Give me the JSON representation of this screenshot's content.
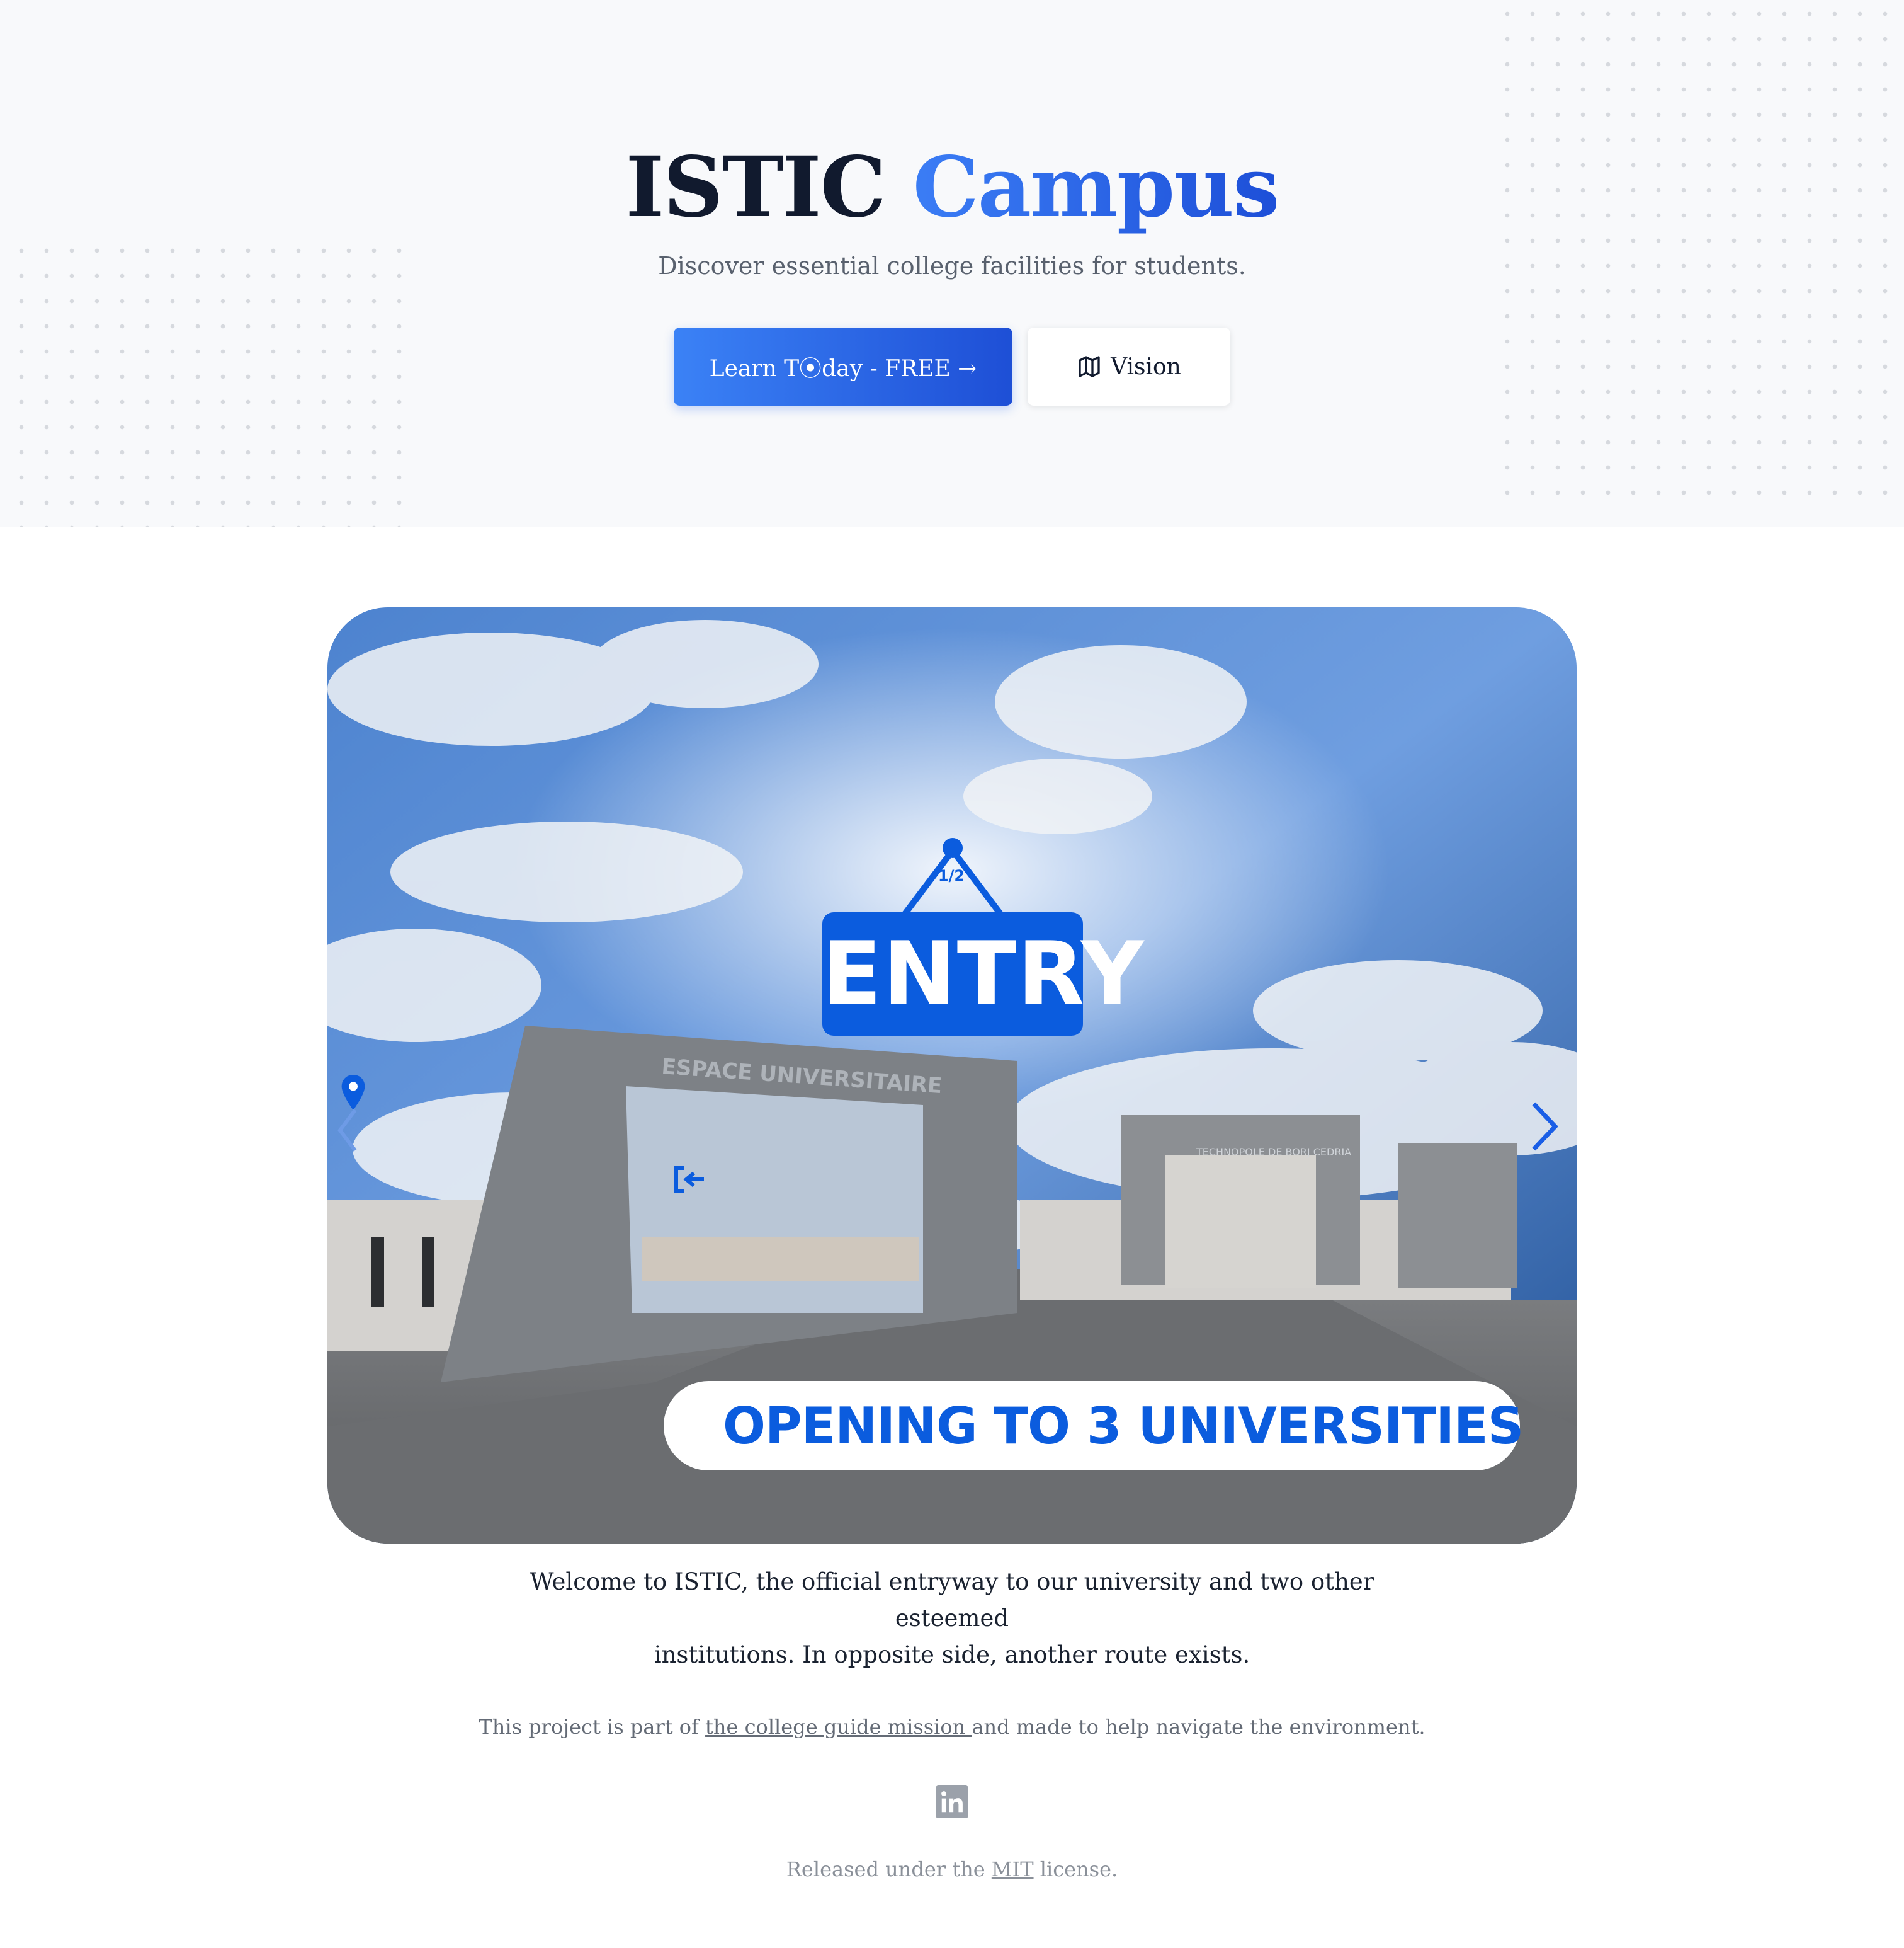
{
  "hero": {
    "title_main": "ISTIC",
    "title_accent": "Campus",
    "subtitle": "Discover essential college facilities for students.",
    "primary_button": "Learn T⦿day - FREE →",
    "secondary_button": "Vision"
  },
  "carousel": {
    "sign_counter": "1/2",
    "sign_label": "ENTRY",
    "banner_text": "OPENING TO 3 UNIVERSITIES",
    "gate_text": "ESPACE UNIVERSITAIRE",
    "side_gate_text": "TECHNOPOLE DE BORJ CEDRIA",
    "caption_line1": "Welcome to ISTIC, the official entryway to our university and two other esteemed",
    "caption_line2": "institutions. In opposite side, another route exists."
  },
  "footer": {
    "note_prefix": "This project is part of ",
    "note_link": "the college guide mission ",
    "note_suffix": "and made to help navigate the environment.",
    "license_prefix": "Released under the ",
    "license_link": "MIT",
    "license_suffix": " license.",
    "social_icon": "linkedin-icon"
  },
  "colors": {
    "accent": "#1d4fd8",
    "sign_blue": "#0b5cde",
    "title_dark": "#111a2e"
  }
}
